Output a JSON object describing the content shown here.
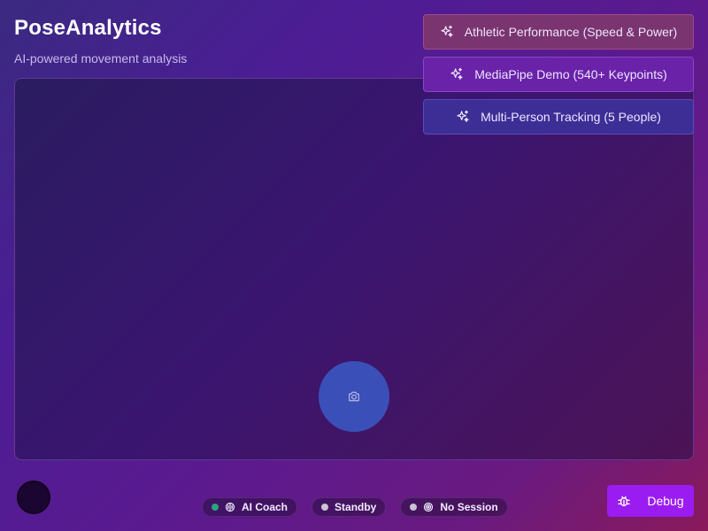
{
  "app": {
    "title": "PoseAnalytics",
    "subtitle": "AI-powered movement analysis"
  },
  "presets": [
    {
      "label": "Athletic Performance (Speed & Power)",
      "icon": "sparkles-icon"
    },
    {
      "label": "MediaPipe Demo (540+ Keypoints)",
      "icon": "sparkles-icon"
    },
    {
      "label": "Multi-Person Tracking (5 People)",
      "icon": "sparkles-icon"
    }
  ],
  "viewport": {
    "camera_icon": "camera-icon"
  },
  "status": {
    "ai_coach": {
      "label": "AI Coach",
      "dot_color": "#2aa37a",
      "icon": "brain-icon"
    },
    "standby": {
      "label": "Standby",
      "dot_color": "#c8c3d6"
    },
    "session": {
      "label": "No Session",
      "dot_color": "#c8c3d6",
      "icon": "target-icon"
    }
  },
  "debug": {
    "label": "Debug",
    "icon": "bug-icon"
  },
  "colors": {
    "accent": "#9b1cf0",
    "camera_button": "#3b4fb8"
  }
}
